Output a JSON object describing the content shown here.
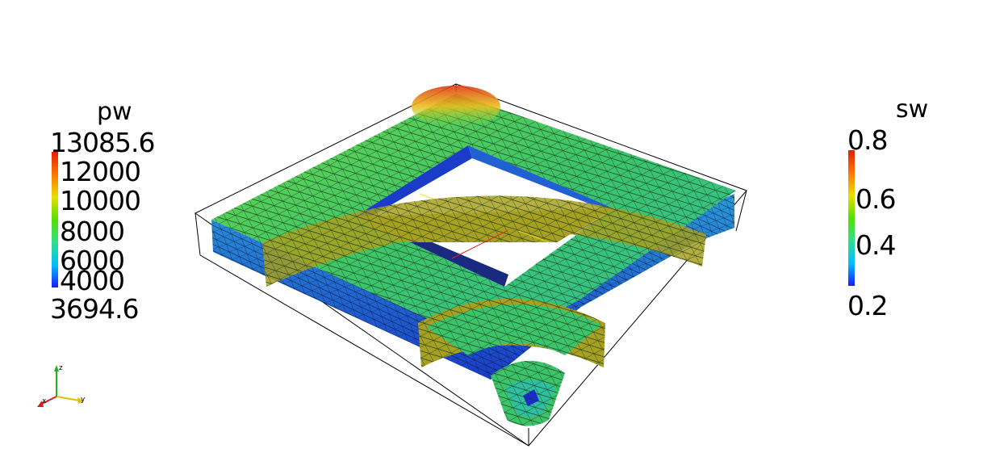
{
  "legends": {
    "pw": {
      "title": "pw",
      "max_label": "13085.6",
      "min_label": "3694.6",
      "ticks": [
        "12000",
        "10000",
        "8000",
        "6000",
        "4000"
      ],
      "range": [
        3694.6,
        13085.6
      ],
      "colormap": [
        "#1a1aff",
        "#00bfff",
        "#2de08a",
        "#52e000",
        "#e8e000",
        "#ff7700",
        "#e02000"
      ]
    },
    "sw": {
      "title": "sw",
      "max_label": "0.8",
      "min_label": "0.2",
      "ticks": [
        "0.6",
        "0.4"
      ],
      "range": [
        0.2,
        0.8
      ],
      "colormap": [
        "#1a1aff",
        "#00bfff",
        "#2de08a",
        "#52e000",
        "#e8e000",
        "#ff7700",
        "#e02000"
      ]
    }
  },
  "orientation_axes": {
    "x": "x",
    "y": "y",
    "z": "z",
    "colors": {
      "x": "#d02020",
      "y": "#e0c000",
      "z": "#20b020"
    }
  },
  "scene": {
    "description_colors": {
      "top_surface": "#3cc46a",
      "side_surface": "#1f4fd0",
      "slice_surface": "#a8a020",
      "hot_corner": "#e05020",
      "bounding_box": "#000000"
    }
  }
}
